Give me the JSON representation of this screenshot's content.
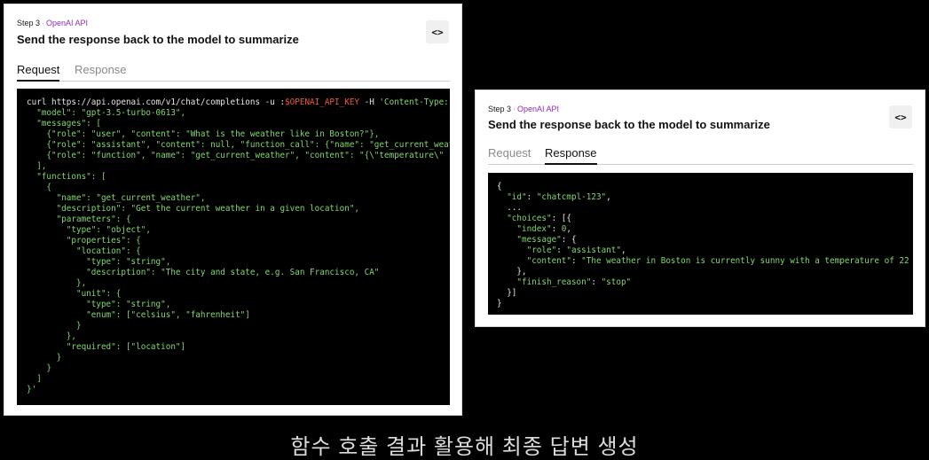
{
  "left_panel": {
    "step_label": "Step 3",
    "separator": "·",
    "api_label": "OpenAI API",
    "title": "Send the response back to the model to summarize",
    "code_toggle": "<>",
    "tabs": [
      {
        "label": "Request",
        "active": true
      },
      {
        "label": "Response",
        "active": false
      }
    ],
    "code_lines": [
      [
        [
          "w",
          "curl https://api.openai.com/v1/chat/completions -u :"
        ],
        [
          "r",
          "$OPENAI_API_KEY"
        ],
        [
          "w",
          " -H "
        ],
        [
          "g",
          "'Content-Type: application/json'"
        ]
      ],
      [
        [
          "g",
          "  \"model\": \"gpt-3.5-turbo-0613\","
        ]
      ],
      [
        [
          "g",
          "  \"messages\": ["
        ]
      ],
      [
        [
          "g",
          "    {\"role\": \"user\", \"content\": \"What is the weather like in Boston?\"},"
        ]
      ],
      [
        [
          "g",
          "    {\"role\": \"assistant\", \"content\": null, \"function_call\": {\"name\": \"get_current_weather\""
        ]
      ],
      [
        [
          "g",
          "    {\"role\": \"function\", \"name\": \"get_current_weather\", \"content\": \"{\\\"temperature\\\""
        ]
      ],
      [
        [
          "g",
          "  ],"
        ]
      ],
      [
        [
          "g",
          "  \"functions\": ["
        ]
      ],
      [
        [
          "g",
          "    {"
        ]
      ],
      [
        [
          "g",
          "      \"name\": \"get_current_weather\","
        ]
      ],
      [
        [
          "g",
          "      \"description\": \"Get the current weather in a given location\","
        ]
      ],
      [
        [
          "g",
          "      \"parameters\": {"
        ]
      ],
      [
        [
          "g",
          "        \"type\": \"object\","
        ]
      ],
      [
        [
          "g",
          "        \"properties\": {"
        ]
      ],
      [
        [
          "g",
          "          \"location\": {"
        ]
      ],
      [
        [
          "g",
          "            \"type\": \"string\","
        ]
      ],
      [
        [
          "g",
          "            \"description\": \"The city and state, e.g. San Francisco, CA\""
        ]
      ],
      [
        [
          "g",
          "          },"
        ]
      ],
      [
        [
          "g",
          "          \"unit\": {"
        ]
      ],
      [
        [
          "g",
          "            \"type\": \"string\","
        ]
      ],
      [
        [
          "g",
          "            \"enum\": [\"celsius\", \"fahrenheit\"]"
        ]
      ],
      [
        [
          "g",
          "          }"
        ]
      ],
      [
        [
          "g",
          "        },"
        ]
      ],
      [
        [
          "g",
          "        \"required\": [\"location\"]"
        ]
      ],
      [
        [
          "g",
          "      }"
        ]
      ],
      [
        [
          "g",
          "    }"
        ]
      ],
      [
        [
          "g",
          "  ]"
        ]
      ],
      [
        [
          "g",
          "}'"
        ]
      ]
    ]
  },
  "right_panel": {
    "step_label": "Step 3",
    "separator": "·",
    "api_label": "OpenAI API",
    "title": "Send the response back to the model to summarize",
    "code_toggle": "<>",
    "tabs": [
      {
        "label": "Request",
        "active": false
      },
      {
        "label": "Response",
        "active": true
      }
    ],
    "code_lines": [
      [
        [
          "w",
          "{"
        ]
      ],
      [
        [
          "w",
          "  "
        ],
        [
          "g",
          "\"id\""
        ],
        [
          "w",
          ": "
        ],
        [
          "g",
          "\"chatcmpl-123\""
        ],
        [
          "w",
          ","
        ]
      ],
      [
        [
          "w",
          "  ..."
        ]
      ],
      [
        [
          "w",
          "  "
        ],
        [
          "g",
          "\"choices\""
        ],
        [
          "w",
          ": [{"
        ]
      ],
      [
        [
          "w",
          "    "
        ],
        [
          "g",
          "\"index\""
        ],
        [
          "w",
          ": "
        ],
        [
          "g",
          "0"
        ],
        [
          "w",
          ","
        ]
      ],
      [
        [
          "w",
          "    "
        ],
        [
          "g",
          "\"message\""
        ],
        [
          "w",
          ": {"
        ]
      ],
      [
        [
          "w",
          "      "
        ],
        [
          "g",
          "\"role\""
        ],
        [
          "w",
          ": "
        ],
        [
          "g",
          "\"assistant\""
        ],
        [
          "w",
          ","
        ]
      ],
      [
        [
          "w",
          "      "
        ],
        [
          "g",
          "\"content\""
        ],
        [
          "w",
          ": "
        ],
        [
          "g",
          "\"The weather in Boston is currently sunny with a temperature of 22"
        ]
      ],
      [
        [
          "w",
          "    },"
        ]
      ],
      [
        [
          "w",
          "    "
        ],
        [
          "g",
          "\"finish_reason\""
        ],
        [
          "w",
          ": "
        ],
        [
          "g",
          "\"stop\""
        ]
      ],
      [
        [
          "w",
          "  }]"
        ]
      ],
      [
        [
          "w",
          "}"
        ]
      ]
    ]
  },
  "caption": "함수 호출 결과 활용해 최종 답변 생성"
}
